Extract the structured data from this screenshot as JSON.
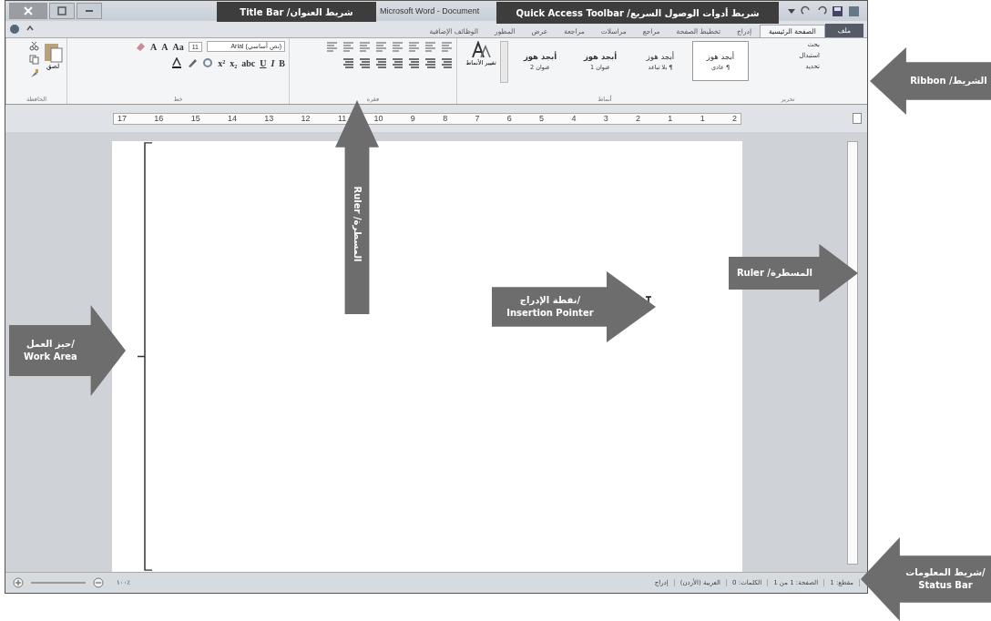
{
  "window": {
    "title": "Microsoft Word - Document"
  },
  "tabs": [
    {
      "label": "ملف",
      "kind": "file",
      "selected": false
    },
    {
      "label": "الصفحة الرئيسية",
      "kind": "tab",
      "selected": true
    },
    {
      "label": "إدراج",
      "kind": "tab",
      "selected": false
    },
    {
      "label": "تخطيط الصفحة",
      "kind": "tab",
      "selected": false
    },
    {
      "label": "مراجع",
      "kind": "tab",
      "selected": false
    },
    {
      "label": "مراسلات",
      "kind": "tab",
      "selected": false
    },
    {
      "label": "مراجعة",
      "kind": "tab",
      "selected": false
    },
    {
      "label": "عرض",
      "kind": "tab",
      "selected": false
    },
    {
      "label": "المطور",
      "kind": "tab",
      "selected": false
    },
    {
      "label": "الوظائف الإضافية",
      "kind": "tab",
      "selected": false
    }
  ],
  "ribbon": {
    "clipboard": {
      "paste": "لصق",
      "label": "الحافظة"
    },
    "font": {
      "name": "(نص أساسي) Arial",
      "size": "11",
      "row1": [
        "Aa",
        "A",
        "A"
      ],
      "row2": [
        "B",
        "I",
        "U",
        "abc",
        "x₂",
        "x²"
      ],
      "label": "خط"
    },
    "paragraph": {
      "label": "فقرة"
    },
    "styles": {
      "items": [
        {
          "sample": "أبجد هوز",
          "name": "¶ عادي",
          "selected": true
        },
        {
          "sample": "أبجد هوز",
          "name": "¶ بلا تباعد",
          "selected": false
        },
        {
          "sample": "أبجد هوز",
          "name": "عنوان 1",
          "selected": false
        },
        {
          "sample": "أبجد هوز",
          "name": "عنوان 2",
          "selected": false
        }
      ],
      "change": "تغيير الأنماط",
      "label": "أنماط"
    },
    "editing": {
      "items": [
        "بحث",
        "استبدال",
        "تحديد"
      ],
      "label": "تحرير"
    }
  },
  "ruler": {
    "numbers": [
      "2",
      "1",
      "1",
      "2",
      "3",
      "4",
      "5",
      "6",
      "7",
      "8",
      "9",
      "10",
      "11",
      "12",
      "13",
      "14",
      "15",
      "16",
      "17"
    ]
  },
  "status_bar": {
    "zoom": "١٠٠٪",
    "items": [
      "مقطع: 1",
      "الصفحة: 1 من 1",
      "الكلمات: 0",
      "العربية (الأردن)",
      "إدراج"
    ]
  },
  "callouts": [
    {
      "text": "Quick Access Toolbar /شريط أدوات الوصول السريع",
      "kind": "label"
    },
    {
      "text": "Title Bar /شريط العنوان",
      "kind": "label"
    },
    {
      "text": "Ribbon /الشريط",
      "kind": "left"
    },
    {
      "text": "Ruler /المسطرة",
      "kind": "up"
    },
    {
      "text": "نقطة الإدراج/ Insertion Pointer",
      "kind": "right"
    },
    {
      "text": "Ruler /المسطرة",
      "kind": "right"
    },
    {
      "text": "حيز العمل/ Work Area",
      "kind": "right"
    },
    {
      "text": "شريط المعلومات/ Status Bar",
      "kind": "left"
    }
  ]
}
